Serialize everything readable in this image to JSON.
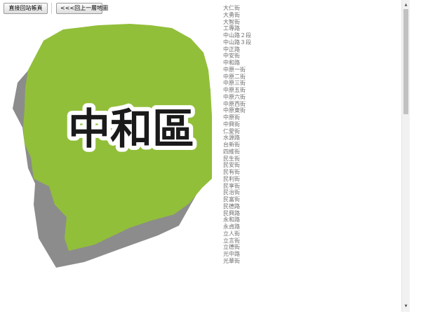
{
  "toolbar": {
    "home_label": "直接回站帳頁",
    "back_label": "<<<回上一層地圖"
  },
  "map": {
    "district_name": "中和區",
    "fill_color": "#92bf3a",
    "shadow_color": "#8c8c8c"
  },
  "streets": [
    "大仁街",
    "大勇街",
    "大智街",
    "工專路",
    "中山路２段",
    "中山路３段",
    "中正路",
    "中安街",
    "中和路",
    "中原一街",
    "中原二街",
    "中原三街",
    "中原五街",
    "中原六街",
    "中原西街",
    "中原東街",
    "中原街",
    "中興街",
    "仁愛街",
    "水源路",
    "台新街",
    "四維街",
    "民生街",
    "民安街",
    "民有街",
    "民利街",
    "民享街",
    "民治街",
    "民富街",
    "民德路",
    "民興路",
    "永和路",
    "永貞路",
    "立人街",
    "立言街",
    "立德街",
    "光中路",
    "光華街"
  ]
}
